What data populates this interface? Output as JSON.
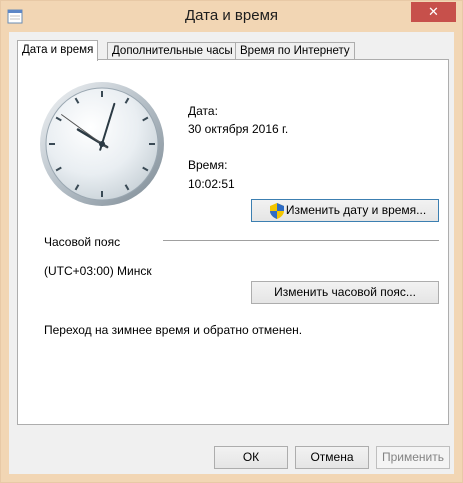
{
  "window": {
    "title": "Дата и время",
    "close_glyph": "✕"
  },
  "tabs": [
    {
      "label": "Дата и время"
    },
    {
      "label": "Дополнительные часы"
    },
    {
      "label": "Время по Интернету"
    }
  ],
  "datetime": {
    "date_label": "Дата:",
    "date_value": "30 октября 2016 г.",
    "time_label": "Время:",
    "time_value": "10:02:51",
    "change_button": "Изменить дату и время..."
  },
  "timezone": {
    "section_label": "Часовой пояс",
    "value": "(UTC+03:00) Минск",
    "change_button": "Изменить часовой пояс...",
    "dst_note": "Переход на зимнее время и обратно отменен."
  },
  "buttons": {
    "ok": "ОК",
    "cancel": "Отмена",
    "apply": "Применить"
  },
  "clock": {
    "hour": 10,
    "minute": 2,
    "second": 51
  },
  "colors": {
    "accent": "#3c7fb1",
    "titlebar": "#f2d6b4",
    "close": "#c7504b"
  }
}
